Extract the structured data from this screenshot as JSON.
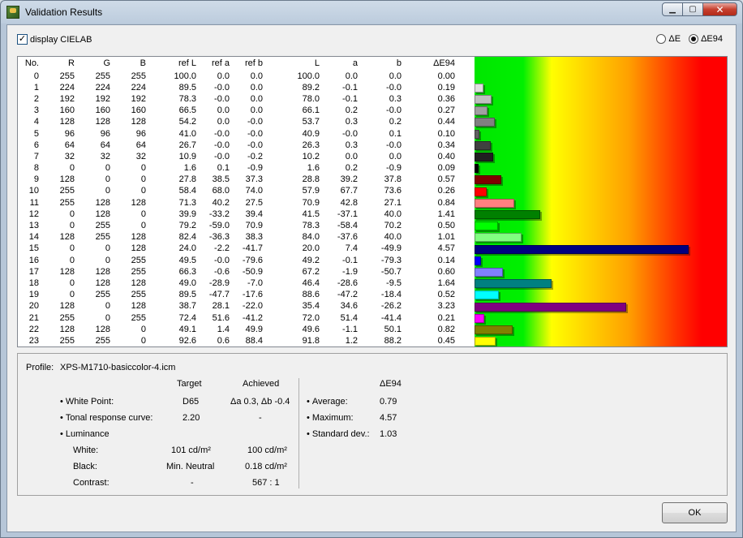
{
  "window": {
    "title": "Validation Results"
  },
  "options": {
    "display_cielab_label": "display CIELAB",
    "display_cielab_checked": true,
    "radio_de_label": "ΔE",
    "radio_de94_label": "ΔE94",
    "selected": "de94"
  },
  "table": {
    "headers": [
      "No.",
      "R",
      "G",
      "B",
      "ref L",
      "ref a",
      "ref b",
      "L",
      "a",
      "b",
      "ΔE94"
    ],
    "rows": [
      [
        "0",
        "255",
        "255",
        "255",
        "100.0",
        "0.0",
        "0.0",
        "100.0",
        "0.0",
        "0.0",
        "0.00"
      ],
      [
        "1",
        "224",
        "224",
        "224",
        "89.5",
        "-0.0",
        "0.0",
        "89.2",
        "-0.1",
        "-0.0",
        "0.19"
      ],
      [
        "2",
        "192",
        "192",
        "192",
        "78.3",
        "-0.0",
        "0.0",
        "78.0",
        "-0.1",
        "0.3",
        "0.36"
      ],
      [
        "3",
        "160",
        "160",
        "160",
        "66.5",
        "0.0",
        "0.0",
        "66.1",
        "0.2",
        "-0.0",
        "0.27"
      ],
      [
        "4",
        "128",
        "128",
        "128",
        "54.2",
        "0.0",
        "-0.0",
        "53.7",
        "0.3",
        "0.2",
        "0.44"
      ],
      [
        "5",
        "96",
        "96",
        "96",
        "41.0",
        "-0.0",
        "-0.0",
        "40.9",
        "-0.0",
        "0.1",
        "0.10"
      ],
      [
        "6",
        "64",
        "64",
        "64",
        "26.7",
        "-0.0",
        "-0.0",
        "26.3",
        "0.3",
        "-0.0",
        "0.34"
      ],
      [
        "7",
        "32",
        "32",
        "32",
        "10.9",
        "-0.0",
        "-0.2",
        "10.2",
        "0.0",
        "0.0",
        "0.40"
      ],
      [
        "8",
        "0",
        "0",
        "0",
        "1.6",
        "0.1",
        "-0.9",
        "1.6",
        "0.2",
        "-0.9",
        "0.09"
      ],
      [
        "9",
        "128",
        "0",
        "0",
        "27.8",
        "38.5",
        "37.3",
        "28.8",
        "39.2",
        "37.8",
        "0.57"
      ],
      [
        "10",
        "255",
        "0",
        "0",
        "58.4",
        "68.0",
        "74.0",
        "57.9",
        "67.7",
        "73.6",
        "0.26"
      ],
      [
        "11",
        "255",
        "128",
        "128",
        "71.3",
        "40.2",
        "27.5",
        "70.9",
        "42.8",
        "27.1",
        "0.84"
      ],
      [
        "12",
        "0",
        "128",
        "0",
        "39.9",
        "-33.2",
        "39.4",
        "41.5",
        "-37.1",
        "40.0",
        "1.41"
      ],
      [
        "13",
        "0",
        "255",
        "0",
        "79.2",
        "-59.0",
        "70.9",
        "78.3",
        "-58.4",
        "70.2",
        "0.50"
      ],
      [
        "14",
        "128",
        "255",
        "128",
        "82.4",
        "-36.3",
        "38.3",
        "84.0",
        "-37.6",
        "40.0",
        "1.01"
      ],
      [
        "15",
        "0",
        "0",
        "128",
        "24.0",
        "-2.2",
        "-41.7",
        "20.0",
        "7.4",
        "-49.9",
        "4.57"
      ],
      [
        "16",
        "0",
        "0",
        "255",
        "49.5",
        "-0.0",
        "-79.6",
        "49.2",
        "-0.1",
        "-79.3",
        "0.14"
      ],
      [
        "17",
        "128",
        "128",
        "255",
        "66.3",
        "-0.6",
        "-50.9",
        "67.2",
        "-1.9",
        "-50.7",
        "0.60"
      ],
      [
        "18",
        "0",
        "128",
        "128",
        "49.0",
        "-28.9",
        "-7.0",
        "46.4",
        "-28.6",
        "-9.5",
        "1.64"
      ],
      [
        "19",
        "0",
        "255",
        "255",
        "89.5",
        "-47.7",
        "-17.6",
        "88.6",
        "-47.2",
        "-18.4",
        "0.52"
      ],
      [
        "20",
        "128",
        "0",
        "128",
        "38.7",
        "28.1",
        "-22.0",
        "35.4",
        "34.6",
        "-26.2",
        "3.23"
      ],
      [
        "21",
        "255",
        "0",
        "255",
        "72.4",
        "51.6",
        "-41.2",
        "72.0",
        "51.4",
        "-41.4",
        "0.21"
      ],
      [
        "22",
        "128",
        "128",
        "0",
        "49.1",
        "1.4",
        "49.9",
        "49.6",
        "-1.1",
        "50.1",
        "0.82"
      ],
      [
        "23",
        "255",
        "255",
        "0",
        "92.6",
        "0.6",
        "88.4",
        "91.8",
        "1.2",
        "88.2",
        "0.45"
      ]
    ],
    "bar_scale_max": 5.0
  },
  "summary": {
    "profile_label": "Profile:",
    "profile_name": "XPS-M1710-basiccolor-4.icm",
    "col_target": "Target",
    "col_achieved": "Achieved",
    "white_point_label": "White Point:",
    "white_point_target": "D65",
    "white_point_achieved": "Δa 0.3, Δb -0.4",
    "trc_label": "Tonal response curve:",
    "trc_target": "2.20",
    "trc_achieved": "-",
    "luminance_label": "Luminance",
    "white_label": "White:",
    "white_target": "101 cd/m²",
    "white_achieved": "100 cd/m²",
    "black_label": "Black:",
    "black_target": "Min. Neutral",
    "black_achieved": "0.18 cd/m²",
    "contrast_label": "Contrast:",
    "contrast_target": "-",
    "contrast_achieved": "567 : 1",
    "de_header": "ΔE94",
    "average_label": "Average:",
    "average_value": "0.79",
    "maximum_label": "Maximum:",
    "maximum_value": "4.57",
    "stddev_label": "Standard dev.:",
    "stddev_value": "1.03"
  },
  "buttons": {
    "ok": "OK"
  }
}
